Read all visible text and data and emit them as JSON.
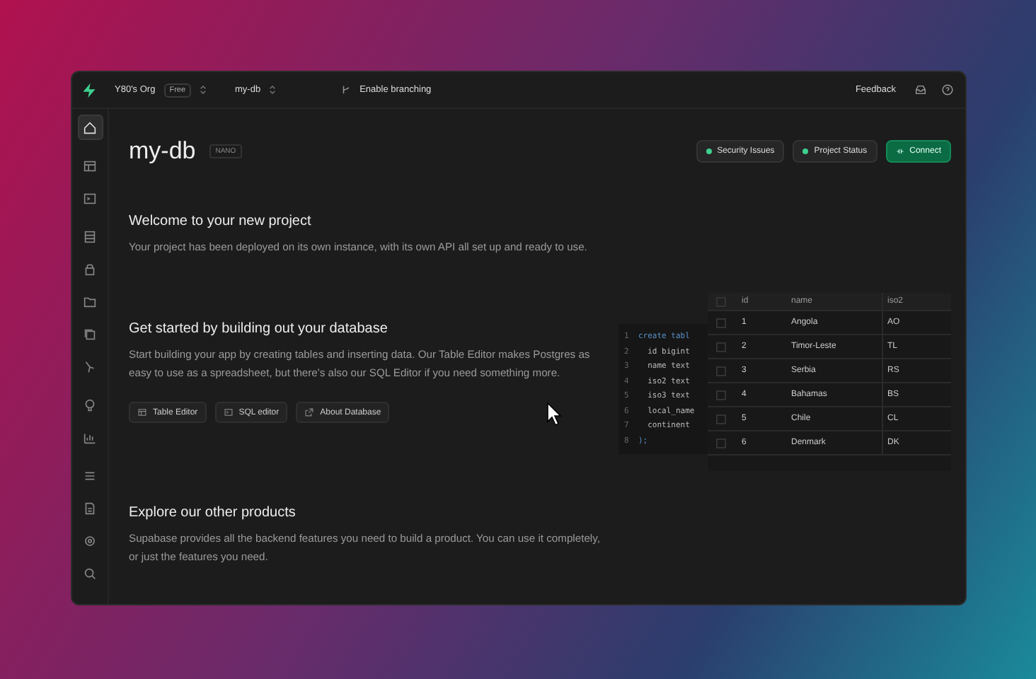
{
  "topbar": {
    "org": "Y80's Org",
    "plan": "Free",
    "project": "my-db",
    "branching": "Enable branching",
    "feedback": "Feedback"
  },
  "sidebar": {
    "items": [
      {
        "selected": true
      },
      {
        "selected": false
      },
      {
        "selected": false
      },
      {
        "selected": false
      },
      {
        "selected": false
      },
      {
        "selected": false
      },
      {
        "selected": false
      },
      {
        "selected": false
      },
      {
        "selected": false
      },
      {
        "selected": false
      },
      {
        "selected": false
      },
      {
        "selected": false
      },
      {
        "selected": false
      },
      {
        "selected": false
      }
    ]
  },
  "header": {
    "title": "my-db",
    "badge": "NANO",
    "buttons": [
      {
        "kind": "status",
        "label": "Security Issues",
        "color": "#3ecf8e"
      },
      {
        "kind": "status",
        "label": "Project Status",
        "color": "#3ecf8e"
      },
      {
        "kind": "primary",
        "label": "Connect"
      }
    ]
  },
  "welcome": {
    "heading": "Welcome to your new project",
    "text": "Your project has been deployed on its own instance, with its own API all set up and ready to use."
  },
  "get_started": {
    "heading": "Get started by building out your database",
    "text": "Start building your app by creating tables and inserting data. Our Table Editor makes Postgres as easy to use as a spreadsheet, but there's also our SQL Editor if you need something more.",
    "buttons": [
      {
        "label": "Table Editor"
      },
      {
        "label": "SQL editor"
      },
      {
        "label": "About Database"
      }
    ],
    "code": [
      {
        "n": "1",
        "text": "create tabl"
      },
      {
        "n": "2",
        "text": "  id bigint"
      },
      {
        "n": "3",
        "text": "  name text"
      },
      {
        "n": "4",
        "text": "  iso2 text"
      },
      {
        "n": "5",
        "text": "  iso3 text"
      },
      {
        "n": "6",
        "text": "  local_name"
      },
      {
        "n": "7",
        "text": "  continent"
      },
      {
        "n": "8",
        "text": ");"
      }
    ],
    "table": {
      "all_checked": false,
      "columns": [
        "id",
        "name",
        "iso2"
      ],
      "rows": [
        {
          "checked": false,
          "cells": [
            "1",
            "Angola",
            "AO"
          ]
        },
        {
          "checked": false,
          "cells": [
            "2",
            "Timor-Leste",
            "TL"
          ]
        },
        {
          "checked": false,
          "cells": [
            "3",
            "Serbia",
            "RS"
          ]
        },
        {
          "checked": false,
          "cells": [
            "4",
            "Bahamas",
            "BS"
          ]
        },
        {
          "checked": false,
          "cells": [
            "5",
            "Chile",
            "CL"
          ]
        },
        {
          "checked": false,
          "cells": [
            "6",
            "Denmark",
            "DK"
          ]
        }
      ]
    }
  },
  "explore": {
    "heading": "Explore our other products",
    "text": "Supabase provides all the backend features you need to build a product. You can use it completely, or just the features you need."
  }
}
